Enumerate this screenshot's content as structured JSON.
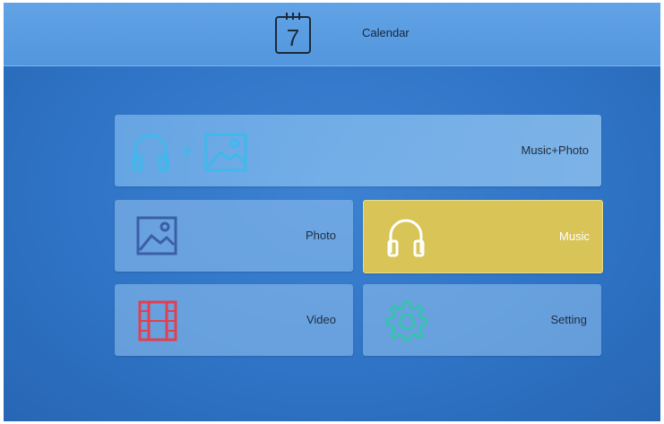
{
  "header": {
    "calendar_day": "7",
    "title": "Calendar"
  },
  "menu": {
    "music_photo": {
      "label": "Music+Photo",
      "icons": [
        "headphones-icon",
        "image-icon"
      ],
      "color": "#3fb9ec"
    },
    "photo": {
      "label": "Photo",
      "icon": "image-icon",
      "color": "#3a5fa8"
    },
    "music": {
      "label": "Music",
      "icon": "headphones-icon",
      "color": "#ffffff",
      "selected": true,
      "highlight": "#d8c457"
    },
    "video": {
      "label": "Video",
      "icon": "film-icon",
      "color": "#e0404f"
    },
    "setting": {
      "label": "Setting",
      "icon": "gear-icon",
      "color": "#2fc7a6"
    }
  }
}
